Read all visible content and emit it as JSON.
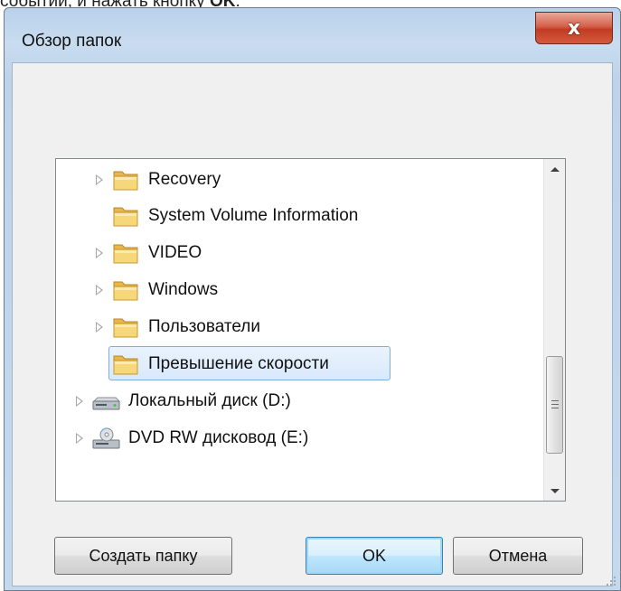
{
  "context": {
    "above_text_prefix": "событий, и нажать кнопку ",
    "above_text_bold": "OK",
    "above_text_suffix": "."
  },
  "window": {
    "title": "Обзор папок",
    "close_label": "x"
  },
  "tree": {
    "items": [
      {
        "label": "Recovery",
        "icon": "folder-icon",
        "expandable": true
      },
      {
        "label": "System Volume Information",
        "icon": "folder-icon",
        "expandable": false
      },
      {
        "label": "VIDEO",
        "icon": "folder-icon",
        "expandable": true
      },
      {
        "label": "Windows",
        "icon": "folder-icon",
        "expandable": true
      },
      {
        "label": "Пользователи",
        "icon": "folder-icon",
        "expandable": true
      },
      {
        "label": "Превышение скорости",
        "icon": "folder-icon",
        "expandable": false,
        "selected": true
      },
      {
        "label": "Локальный диск (D:)",
        "icon": "hard-drive-icon",
        "expandable": true
      },
      {
        "label": "DVD RW дисковод (E:)",
        "icon": "dvd-drive-icon",
        "expandable": true
      }
    ]
  },
  "buttons": {
    "new_folder": "Создать папку",
    "ok": "OK",
    "cancel": "Отмена"
  },
  "colors": {
    "titlebar": "#c4d8ee",
    "close_button": "#c23b22",
    "selection_border": "#84acdd",
    "default_button_border": "#3c7fb1"
  }
}
